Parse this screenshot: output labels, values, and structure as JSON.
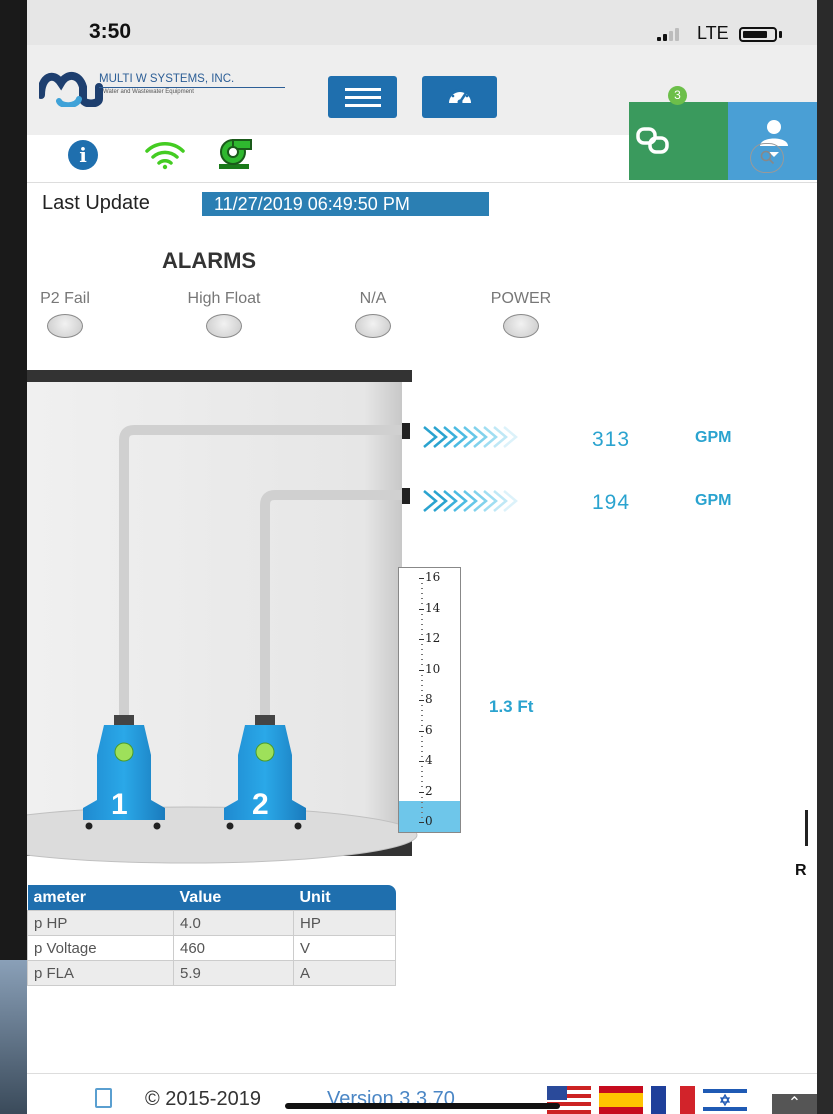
{
  "status_bar": {
    "time": "3:50",
    "network": "LTE"
  },
  "header": {
    "company_name": "MULTI W SYSTEMS, INC.",
    "company_tagline": "Water and Wastewater Equipment",
    "notification_count": "3"
  },
  "last_update": {
    "label": "Last Update",
    "value": "11/27/2019 06:49:50 PM"
  },
  "alarms": {
    "title": "ALARMS",
    "items": [
      {
        "label": "P2 Fail"
      },
      {
        "label": "High Float"
      },
      {
        "label": "N/A"
      },
      {
        "label": "POWER"
      }
    ]
  },
  "flows": [
    {
      "value": "313",
      "unit": "GPM"
    },
    {
      "value": "194",
      "unit": "GPM"
    }
  ],
  "level_gauge": {
    "ticks": [
      "16",
      "14",
      "12",
      "10",
      "8",
      "6",
      "4",
      "2",
      "0"
    ],
    "fill_fraction": 0.08
  },
  "level_reading": "1.3  Ft",
  "pumps": [
    {
      "number": "1"
    },
    {
      "number": "2"
    }
  ],
  "right_clip_label": "R",
  "params_table": {
    "headers": [
      "ameter",
      "Value",
      "Unit"
    ],
    "rows": [
      [
        "p HP",
        "4.0",
        "HP"
      ],
      [
        "p Voltage",
        "460",
        "V"
      ],
      [
        "p FLA",
        "5.9",
        "A"
      ]
    ]
  },
  "footer": {
    "copyright": "© 2015-2019",
    "version": "Version 3.3.70"
  },
  "colors": {
    "brand_blue": "#1f6fae",
    "accent_cyan": "#2aa3cf",
    "link_green": "#3a9a5d",
    "user_blue": "#4a9fd5"
  }
}
